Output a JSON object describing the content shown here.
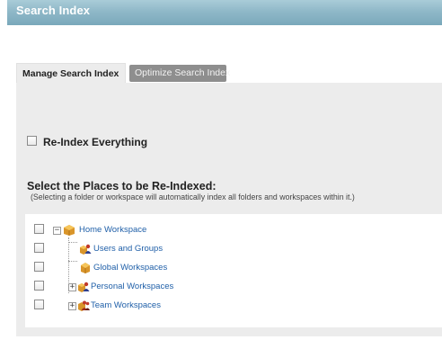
{
  "window": {
    "title": "Search Index"
  },
  "tabs": [
    {
      "label": "Manage Search Index",
      "active": true
    },
    {
      "label": "Optimize Search Index",
      "active": false
    }
  ],
  "reindex_everything": {
    "label": "Re-Index Everything",
    "checked": false
  },
  "places": {
    "heading": "Select the Places to be Re-Indexed:",
    "note": "(Selecting a folder or workspace will automatically index all folders and workspaces within it.)"
  },
  "tree": [
    {
      "label": "Home Workspace",
      "icon": "home-workspace-icon",
      "checked": false,
      "expander": "collapse"
    },
    {
      "label": "Users and Groups",
      "icon": "users-groups-icon",
      "checked": false,
      "expander": null
    },
    {
      "label": "Global Workspaces",
      "icon": "global-workspace-icon",
      "checked": false,
      "expander": null
    },
    {
      "label": "Personal Workspaces",
      "icon": "personal-workspaces-icon",
      "checked": false,
      "expander": "expand"
    },
    {
      "label": "Team Workspaces",
      "icon": "team-workspaces-icon",
      "checked": false,
      "expander": "expand"
    }
  ],
  "colors": {
    "title_bar": "#8fb8c8",
    "link": "#1f5fa8",
    "panel": "#ececec",
    "inactive_tab": "#8e8e8e"
  }
}
